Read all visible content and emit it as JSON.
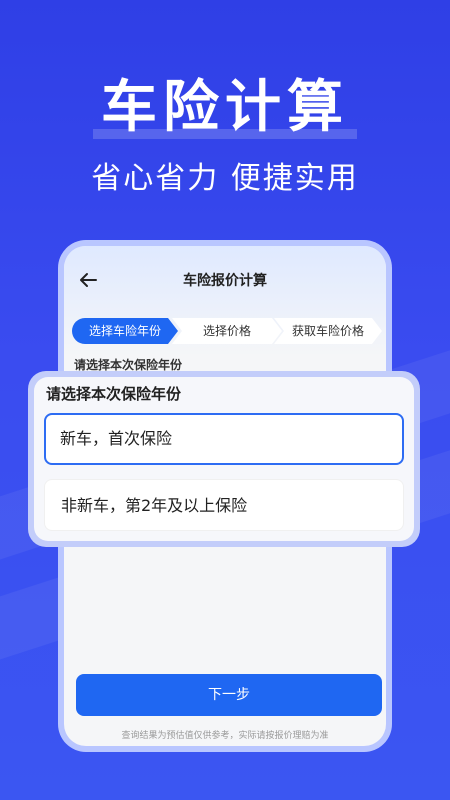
{
  "hero": {
    "title": "车险计算",
    "subtitle": "省心省力 便捷实用"
  },
  "app": {
    "nav_title": "车险报价计算",
    "steps": [
      {
        "label": "选择车险年份",
        "active": true
      },
      {
        "label": "选择价格",
        "active": false
      },
      {
        "label": "获取车险价格",
        "active": false
      }
    ],
    "section_label": "请选择本次保险年份",
    "next_button": "下一步",
    "disclaimer": "查询结果为预估值仅供参考，实际请按报价理赔为准"
  },
  "popup": {
    "title": "请选择本次保险年份",
    "options": [
      {
        "label": "新车，首次保险",
        "selected": true
      },
      {
        "label": "非新车，第2年及以上保险",
        "selected": false
      }
    ]
  },
  "colors": {
    "background": "#3a4cf0",
    "accent": "#1f67f2",
    "selected_border": "#2d6cf3"
  }
}
